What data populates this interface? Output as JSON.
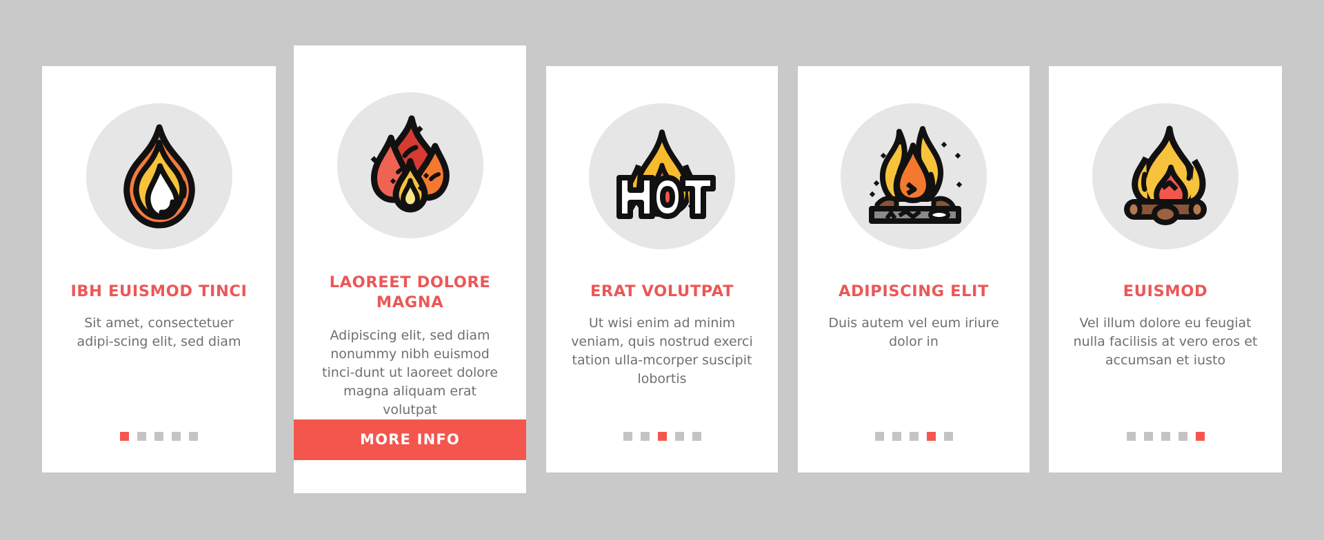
{
  "page": {
    "background_color": "#c9c9c9",
    "card_background": "#ffffff",
    "accent_color": "#ec5757",
    "button_color": "#f4564e",
    "icon_circle_color": "#e6e6e6",
    "body_text_color": "#6f6f6f",
    "dot_inactive_color": "#c4c4c4",
    "dot_active_color": "#f4564e"
  },
  "cards": [
    {
      "icon": "flame-icon",
      "title": "IBH EUISMOD TINCI",
      "body": "Sit amet, consectetuer adipi-scing elit, sed diam",
      "dots": {
        "count": 5,
        "active_index": 0
      },
      "has_button": false
    },
    {
      "icon": "bonfire-flames-icon",
      "title": "LAOREET DOLORE MAGNA",
      "body": "Adipiscing elit, sed diam nonummy nibh euismod tinci-dunt ut laoreet dolore magna aliquam erat volutpat",
      "dots": null,
      "has_button": true,
      "button_label": "MORE INFO"
    },
    {
      "icon": "hot-flame-icon",
      "title": "ERAT VOLUTPAT",
      "body": "Ut wisi enim ad minim veniam, quis nostrud exerci tation ulla-mcorper suscipit lobortis",
      "dots": {
        "count": 5,
        "active_index": 2
      },
      "has_button": false
    },
    {
      "icon": "campfire-coals-icon",
      "title": "ADIPISCING ELIT",
      "body": "Duis autem vel eum iriure dolor in",
      "dots": {
        "count": 5,
        "active_index": 3
      },
      "has_button": false
    },
    {
      "icon": "campfire-logs-icon",
      "title": "EUISMOD",
      "body": "Vel illum dolore eu feugiat nulla facilisis at vero eros et accumsan et iusto",
      "dots": {
        "count": 5,
        "active_index": 4
      },
      "has_button": false
    }
  ]
}
